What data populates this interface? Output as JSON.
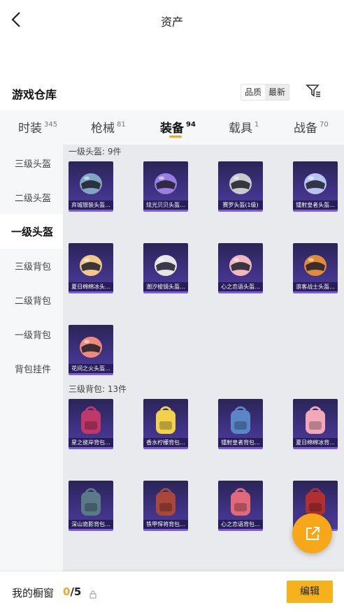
{
  "header": {
    "title": "资产",
    "back_icon": "chevron-left-icon"
  },
  "warehouse": {
    "title": "游戏仓库",
    "sort_options": [
      "品质",
      "最新"
    ],
    "filter_icon": "filter-icon"
  },
  "tabs": [
    {
      "label": "时装",
      "count": "345",
      "active": false
    },
    {
      "label": "枪械",
      "count": "81",
      "active": false
    },
    {
      "label": "装备",
      "count": "94",
      "active": true
    },
    {
      "label": "载具",
      "count": "1",
      "active": false
    },
    {
      "label": "战备",
      "count": "70",
      "active": false
    }
  ],
  "sidebar": {
    "items": [
      {
        "label": "三级头盔"
      },
      {
        "label": "二级头盔"
      },
      {
        "label": "一级头盔",
        "active": true
      },
      {
        "label": "三级背包"
      },
      {
        "label": "二级背包"
      },
      {
        "label": "一级背包"
      },
      {
        "label": "背包挂件"
      }
    ]
  },
  "sections": [
    {
      "label": "一级头盔: 9件",
      "items": [
        {
          "name": "弃城银装头盔...",
          "color": "#7fa7c4"
        },
        {
          "name": "炫光贝贝头盔...",
          "color": "#9a7fe0"
        },
        {
          "name": "赛罗头盔(1级)",
          "color": "#c9c9d0"
        },
        {
          "name": "镭射皇者头盔...",
          "color": "#b8c4f0"
        },
        {
          "name": "夏日绵绵冰头...",
          "color": "#f2c98a"
        },
        {
          "name": "潮汐梭镜头盔...",
          "color": "#e6e6e6"
        },
        {
          "name": "心之恋语头盔...",
          "color": "#f0b8c0"
        },
        {
          "name": "浪客战士头盔...",
          "color": "#e08a3c"
        },
        {
          "name": "花间之火头盔...",
          "color": "#f08a7a"
        }
      ]
    },
    {
      "label": "三级背包: 13件",
      "items": [
        {
          "name": "星之彼岸背包...",
          "color": "#c0386a"
        },
        {
          "name": "香水柠檬背包...",
          "color": "#f2d24a"
        },
        {
          "name": "镭射皇者背包...",
          "color": "#5a86c8"
        },
        {
          "name": "夏日绵绵冰背...",
          "color": "#f2a8b8"
        },
        {
          "name": "深山诡影背包...",
          "color": "#5a7a8a"
        },
        {
          "name": "铁甲悍将背包...",
          "color": "#a8483a"
        },
        {
          "name": "心之恋语背包...",
          "color": "#e06a7a"
        },
        {
          "name": "",
          "color": "#b03030"
        }
      ]
    }
  ],
  "showcase": {
    "label": "我的橱窗",
    "current": "0",
    "total": "/5",
    "edit_label": "编辑"
  },
  "fab_icon": "external-link-icon",
  "colors": {
    "accent": "#f5a623",
    "card_bg": "#3f3284"
  }
}
